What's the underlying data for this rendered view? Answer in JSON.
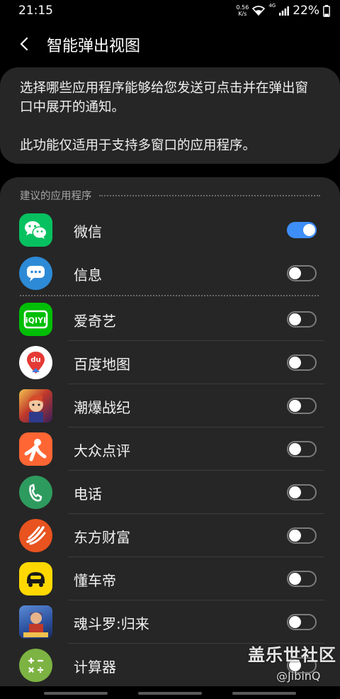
{
  "status_bar": {
    "time": "21:15",
    "net_speed_value": "0.56",
    "net_speed_unit": "K/s",
    "network_type": "4G",
    "battery": "22%"
  },
  "app_bar": {
    "title": "智能弹出视图"
  },
  "description": {
    "paragraph1": "选择哪些应用程序能够给您发送可点击并在弹出窗口中展开的通知。",
    "paragraph2": "此功能仅适用于支持多窗口的应用程序。"
  },
  "list": {
    "section_title": "建议的应用程序",
    "apps": [
      {
        "label": "微信",
        "enabled": true,
        "icon": "wechat-icon",
        "color": "#07c160"
      },
      {
        "label": "信息",
        "enabled": false,
        "icon": "messages-icon",
        "color": "#2d8ad6"
      },
      {
        "label": "爱奇艺",
        "enabled": false,
        "icon": "iqiyi-icon",
        "color": "#00be06"
      },
      {
        "label": "百度地图",
        "enabled": false,
        "icon": "baidu-map-icon",
        "color": "#ffffff"
      },
      {
        "label": "潮爆战纪",
        "enabled": false,
        "icon": "game-icon",
        "color": "#8a3a2a"
      },
      {
        "label": "大众点评",
        "enabled": false,
        "icon": "dianping-icon",
        "color": "#ff6633"
      },
      {
        "label": "电话",
        "enabled": false,
        "icon": "phone-icon",
        "color": "#2e9b5e"
      },
      {
        "label": "东方财富",
        "enabled": false,
        "icon": "eastmoney-icon",
        "color": "#e8531f"
      },
      {
        "label": "懂车帝",
        "enabled": false,
        "icon": "dongchedi-icon",
        "color": "#ffd800"
      },
      {
        "label": "魂斗罗:归来",
        "enabled": false,
        "icon": "contra-icon",
        "color": "#2a4f9c"
      },
      {
        "label": "计算器",
        "enabled": false,
        "icon": "calculator-icon",
        "color": "#7cb342"
      }
    ]
  },
  "watermark": {
    "brand": "盖乐世社区",
    "user": "@JibinQ"
  },
  "colors": {
    "accent": "#3e8ef7",
    "card_bg": "#262626",
    "page_bg": "#000000"
  }
}
